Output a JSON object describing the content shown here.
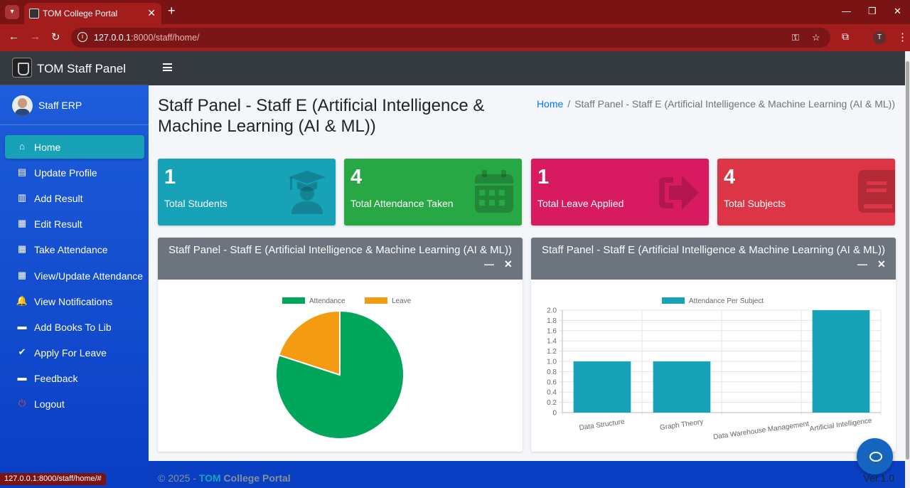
{
  "browser": {
    "tab_title": "TOM College Portal",
    "url_host": "127.0.0.1",
    "url_path": ":8000/staff/home/",
    "status_url": "127.0.0.1:8000/staff/home/#",
    "profile_initial": "T"
  },
  "brand": {
    "title": "TOM Staff Panel"
  },
  "user": {
    "name": "Staff ERP"
  },
  "sidebar": {
    "items": [
      {
        "label": "Home",
        "icon": "home-icon",
        "glyph": "⌂",
        "active": true
      },
      {
        "label": "Update Profile",
        "icon": "id-card-icon",
        "glyph": "▤"
      },
      {
        "label": "Add Result",
        "icon": "chart-icon",
        "glyph": "▥"
      },
      {
        "label": "Edit Result",
        "icon": "table-icon",
        "glyph": "▦"
      },
      {
        "label": "Take Attendance",
        "icon": "calendar-icon",
        "glyph": "▦"
      },
      {
        "label": "View/Update Attendance",
        "icon": "table-icon",
        "glyph": "▦"
      },
      {
        "label": "View Notifications",
        "icon": "bell-icon",
        "glyph": "🔔"
      },
      {
        "label": "Add Books To Lib",
        "icon": "comment-icon",
        "glyph": "▬"
      },
      {
        "label": "Apply For Leave",
        "icon": "check-icon",
        "glyph": "✔"
      },
      {
        "label": "Feedback",
        "icon": "comment-icon",
        "glyph": "▬"
      },
      {
        "label": "Logout",
        "icon": "power-icon",
        "glyph": "⏻"
      }
    ]
  },
  "page": {
    "title": "Staff Panel - Staff E (Artificial Intelligence & Machine Learning (AI & ML))",
    "breadcrumb_home": "Home",
    "breadcrumb_sep": "/",
    "breadcrumb_current": "Staff Panel - Staff E (Artificial Intelligence & Machine Learning (AI & ML))"
  },
  "stats": [
    {
      "value": "1",
      "label": "Total Students",
      "icon": "graduation-cap-icon",
      "color": "#17a2b8"
    },
    {
      "value": "4",
      "label": "Total Attendance Taken",
      "icon": "calendar-icon",
      "color": "#28a745"
    },
    {
      "value": "1",
      "label": "Total Leave Applied",
      "icon": "sign-out-icon",
      "color": "#d81b60"
    },
    {
      "value": "4",
      "label": "Total Subjects",
      "icon": "book-icon",
      "color": "#dc3545"
    }
  ],
  "cards": {
    "left_title": "Staff Panel - Staff E (Artificial Intelligence & Machine Learning (AI & ML))",
    "right_title": "Staff Panel - Staff E (Artificial Intelligence & Machine Learning (AI & ML))",
    "minus": "—",
    "close": "✕"
  },
  "chart_data": [
    {
      "type": "pie",
      "categories": [
        "Attendance",
        "Leave"
      ],
      "values": [
        4,
        1
      ],
      "colors": [
        "#00a65a",
        "#f39c12"
      ],
      "legend": "top"
    },
    {
      "type": "bar",
      "categories": [
        "Data Structure",
        "Graph Theory",
        "Data Warehouse Management",
        "Artificial Intelligence"
      ],
      "series": [
        {
          "name": "Attendance Per Subject",
          "values": [
            1,
            1,
            0,
            2
          ],
          "color": "#17a2b8"
        }
      ],
      "ylim": [
        0,
        2.0
      ],
      "yticks": [
        "0",
        "0.2",
        "0.4",
        "0.6",
        "0.8",
        "1.0",
        "1.2",
        "1.4",
        "1.6",
        "1.8",
        "2.0"
      ],
      "grid": true,
      "legend": "top"
    }
  ],
  "footer": {
    "copy_prefix": "© 2025 - ",
    "brand_link": "TOM",
    "brand_rest": " College Portal",
    "version": "Ver.1.0"
  }
}
